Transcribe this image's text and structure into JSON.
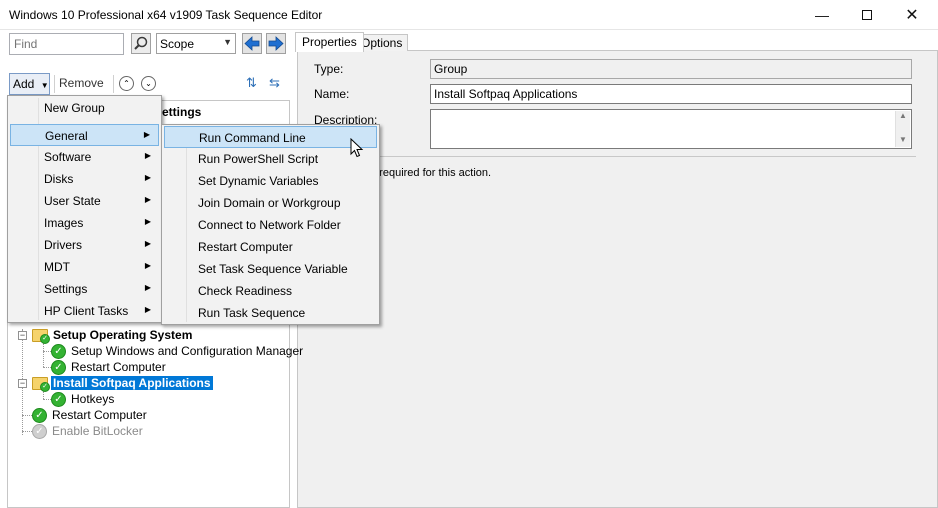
{
  "window": {
    "title": "Windows 10 Professional x64 v1909 Task Sequence Editor"
  },
  "toolbar": {
    "find_placeholder": "Find",
    "scope_value": "Scope"
  },
  "left_toolbar": {
    "add_label": "Add",
    "remove_label": "Remove"
  },
  "tabs": [
    {
      "label": "Properties"
    },
    {
      "label": "Options"
    }
  ],
  "properties": {
    "type_label": "Type:",
    "type_value": "Group",
    "name_label": "Name:",
    "name_value": "Install Softpaq Applications",
    "description_label": "Description:",
    "description_value": "",
    "hint_text": "e required  for this action."
  },
  "partial_header": "ettings",
  "tree": [
    {
      "label": "Setup Operating System",
      "icon": "folder-check-icon",
      "bold": true
    },
    {
      "label": "Setup Windows and Configuration Manager",
      "icon": "check-icon"
    },
    {
      "label": "Restart Computer",
      "icon": "check-icon"
    },
    {
      "label": "Install Softpaq Applications",
      "icon": "folder-check-icon",
      "bold": true,
      "selected": true
    },
    {
      "label": "Hotkeys",
      "icon": "check-icon"
    },
    {
      "label": "Restart Computer",
      "icon": "check-icon"
    },
    {
      "label": "Enable BitLocker",
      "icon": "check-disabled-icon",
      "disabled": true
    }
  ],
  "add_menu": [
    {
      "label": "New Group",
      "submenu": false
    },
    {
      "label": "General",
      "submenu": true,
      "highlighted": true
    },
    {
      "label": "Software",
      "submenu": true
    },
    {
      "label": "Disks",
      "submenu": true
    },
    {
      "label": "User State",
      "submenu": true
    },
    {
      "label": "Images",
      "submenu": true
    },
    {
      "label": "Drivers",
      "submenu": true
    },
    {
      "label": "MDT",
      "submenu": true
    },
    {
      "label": "Settings",
      "submenu": true
    },
    {
      "label": "HP Client Tasks",
      "submenu": true
    }
  ],
  "general_submenu": [
    {
      "label": "Run Command Line",
      "highlighted": true
    },
    {
      "label": "Run PowerShell Script"
    },
    {
      "label": "Set Dynamic Variables"
    },
    {
      "label": "Join Domain or Workgroup"
    },
    {
      "label": "Connect to Network Folder"
    },
    {
      "label": "Restart Computer"
    },
    {
      "label": "Set Task Sequence Variable"
    },
    {
      "label": "Check Readiness"
    },
    {
      "label": "Run Task Sequence"
    }
  ],
  "colors": {
    "selection": "#0078d7",
    "menu_highlight": "#cce4f7",
    "check_green": "#34b233",
    "folder_yellow": "#f5d36c",
    "nav_arrow_blue": "#1f6fd1"
  }
}
